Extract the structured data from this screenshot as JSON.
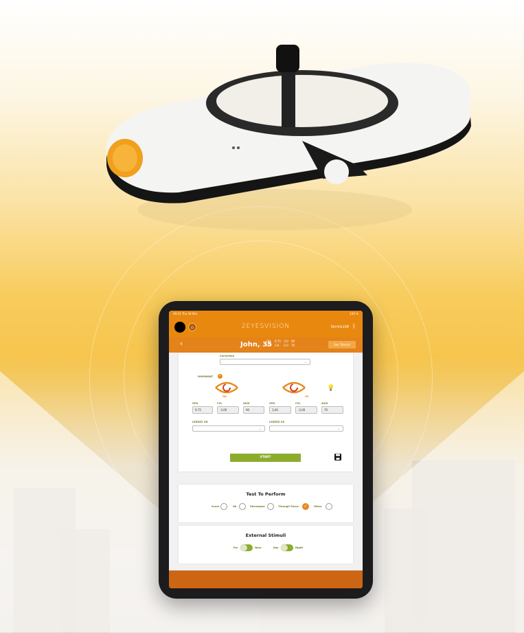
{
  "colors": {
    "accent": "#e9880f",
    "bottom_bar": "#cc6614",
    "green": "#8cac2e"
  },
  "status_bar": {
    "time": "09:41",
    "date": "Thu 26 Mar",
    "battery": "100 %"
  },
  "header": {
    "brand": "2EYESVISION",
    "device_name": "SimVis108",
    "icons": {
      "avatar": "avatar",
      "home": "home-icon",
      "bluetooth": "bluetooth-icon"
    }
  },
  "patient_bar": {
    "back_icon": "‹",
    "patient": "John, 35",
    "rx": [
      {
        "eye": "OD",
        "sph": "9.75",
        "cyl": "-3.0",
        "axis": "90"
      },
      {
        "eye": "OS",
        "sph": "3.6",
        "cyl": "-2.0",
        "axis": "70"
      }
    ],
    "tutorial_button": "See Tutorial"
  },
  "form": {
    "correction_label": "Correction",
    "correction_value": "",
    "dominant_label": "DOMINANT",
    "od_label": "OD",
    "os_label": "OS",
    "fields": [
      {
        "label": "SPH",
        "value": "9,75"
      },
      {
        "label": "CYL",
        "value": "-3,00"
      },
      {
        "label": "AXIS",
        "value": "90"
      },
      {
        "label": "SPH",
        "value": "3,00"
      },
      {
        "label": "CYL",
        "value": "-2,00"
      },
      {
        "label": "AXIS",
        "value": "70"
      }
    ],
    "lenses_od_label": "LENSES OD",
    "lenses_os_label": "LENSES OS",
    "start_button": "START"
  },
  "test_to_perform": {
    "title": "Test To Perform",
    "options": [
      {
        "label": "Score",
        "selected": false
      },
      {
        "label": "VA",
        "selected": false
      },
      {
        "label": "Stereopsis",
        "selected": false
      },
      {
        "label": "Through Focus",
        "selected": true
      },
      {
        "label": "Other",
        "selected": false
      }
    ]
  },
  "external_stimuli": {
    "title": "External Stimuli",
    "toggles": [
      {
        "left": "Far",
        "right": "Near"
      },
      {
        "left": "Day",
        "right": "Night"
      }
    ]
  }
}
